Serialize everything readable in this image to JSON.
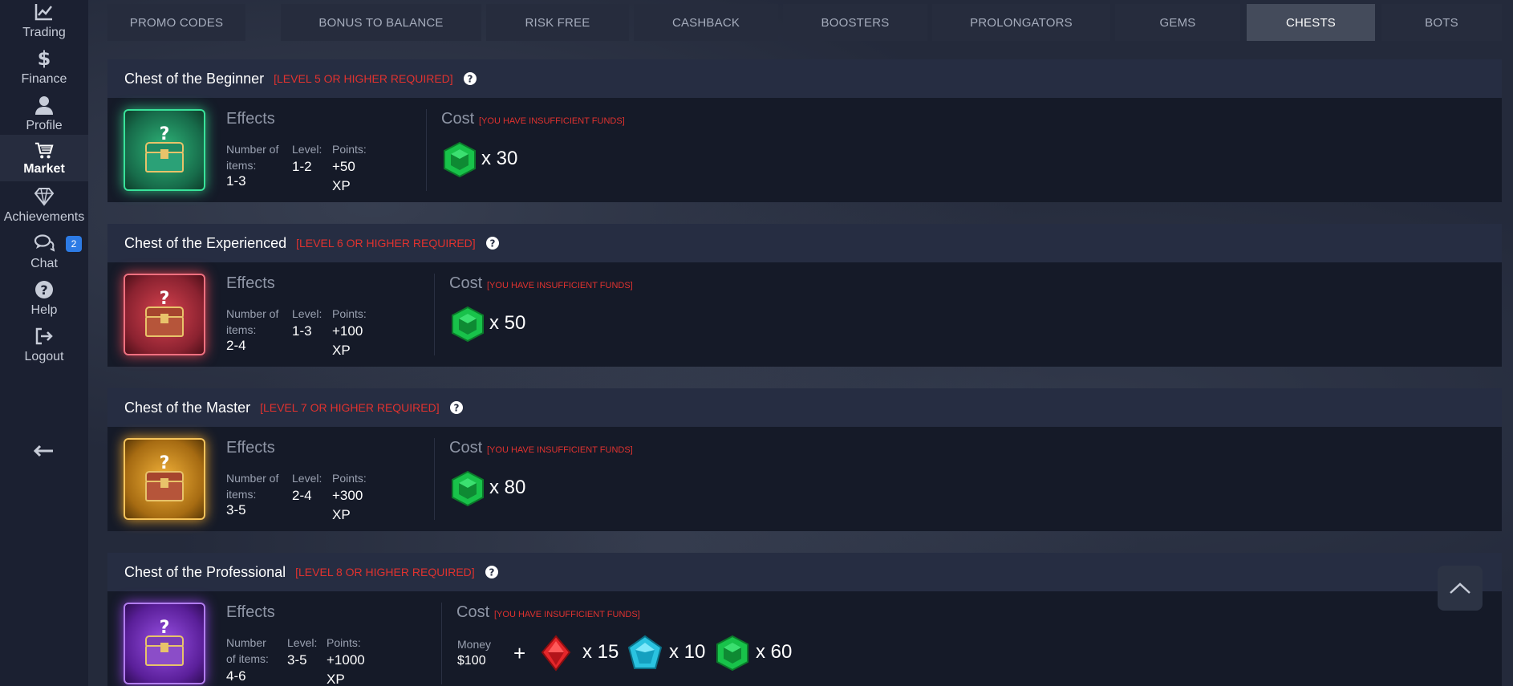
{
  "sidebar": {
    "items": [
      {
        "label": "Trading",
        "icon": "chart-line-icon"
      },
      {
        "label": "Finance",
        "icon": "dollar-icon"
      },
      {
        "label": "Profile",
        "icon": "user-icon"
      },
      {
        "label": "Market",
        "icon": "cart-icon"
      },
      {
        "label": "Achievements",
        "icon": "diamond-icon"
      },
      {
        "label": "Chat",
        "icon": "chat-icon",
        "badge": "2"
      },
      {
        "label": "Help",
        "icon": "help-icon"
      },
      {
        "label": "Logout",
        "icon": "logout-icon"
      }
    ]
  },
  "tabs": [
    {
      "label": "Promo codes"
    },
    {
      "label": "Bonus to balance"
    },
    {
      "label": "Risk free"
    },
    {
      "label": "Cashback"
    },
    {
      "label": "Boosters"
    },
    {
      "label": "Prolongators"
    },
    {
      "label": "Gems"
    },
    {
      "label": "Chests"
    },
    {
      "label": "Bots"
    }
  ],
  "active_tab": "Chests",
  "labels": {
    "effects": "Effects",
    "number_of_items": "Number of items:",
    "level": "Level:",
    "points": "Points:",
    "cost": "Cost",
    "insufficient": "[You have insufficient funds]",
    "money": "Money",
    "plus": "+"
  },
  "chests": [
    {
      "title": "Chest of the Beginner",
      "requirement": "[Level 5 or higher required]",
      "items": "1-3",
      "level": "1-2",
      "points": "+50 XP",
      "color": "#2fb77a",
      "cost": [
        {
          "gem": "green",
          "qty": "x 30"
        }
      ]
    },
    {
      "title": "Chest of the Experienced",
      "requirement": "[Level 6 or higher required]",
      "items": "2-4",
      "level": "1-3",
      "points": "+100 XP",
      "color": "#d9434f",
      "cost": [
        {
          "gem": "green",
          "qty": "x 50"
        }
      ]
    },
    {
      "title": "Chest of the Master",
      "requirement": "[Level 7 or higher required]",
      "items": "3-5",
      "level": "2-4",
      "points": "+300 XP",
      "color": "#e8a22a",
      "cost": [
        {
          "gem": "green",
          "qty": "x 80"
        }
      ]
    },
    {
      "title": "Chest of the Professional",
      "requirement": "[Level 8 or higher required]",
      "items": "4-6",
      "level": "3-5",
      "points": "+1000 XP",
      "color": "#8a3fd6",
      "money": "$100",
      "cost": [
        {
          "gem": "red",
          "qty": "x 15"
        },
        {
          "gem": "blue",
          "qty": "x 10"
        },
        {
          "gem": "green",
          "qty": "x 60"
        }
      ]
    }
  ],
  "colors": {
    "gem_green": "#18c24a",
    "gem_red": "#e5262a",
    "gem_blue": "#2ac3e0",
    "warn": "#e0322f"
  }
}
